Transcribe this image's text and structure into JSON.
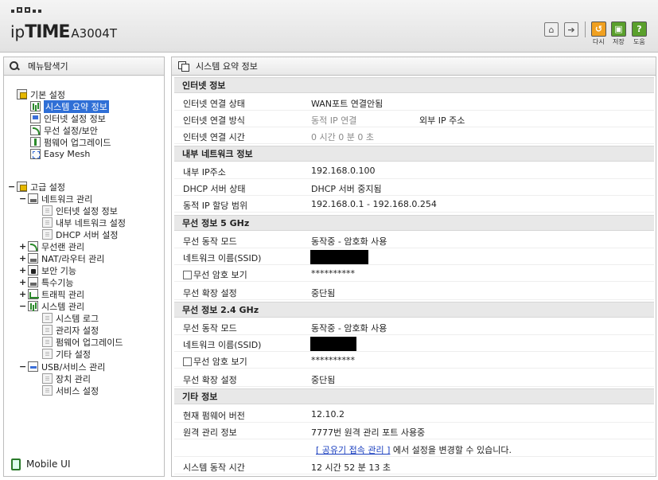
{
  "header": {
    "brand_ip": "ip",
    "brand_time": "TIME",
    "model": "A3004T",
    "buttons": [
      {
        "icon": "home-icon",
        "label": ""
      },
      {
        "icon": "logout-icon",
        "label": ""
      },
      {
        "icon": "refresh-icon",
        "label": "다시",
        "color": "#f0a020"
      },
      {
        "icon": "save-icon",
        "label": "저장",
        "color": "#5aa02c"
      },
      {
        "icon": "help-icon",
        "label": "도움",
        "color": "#5aa02c"
      }
    ]
  },
  "sidebar": {
    "title": "메뉴탐색기",
    "basic": {
      "label": "기본 설정",
      "items": [
        "시스템 요약 정보",
        "인터넷 설정 정보",
        "무선 설정/보안",
        "펌웨어 업그레이드",
        "Easy Mesh"
      ]
    },
    "advanced": {
      "label": "고급 설정",
      "network": {
        "label": "네트워크 관리",
        "items": [
          "인터넷 설정 정보",
          "내부 네트워크 설정",
          "DHCP 서버 설정"
        ]
      },
      "groups": [
        "무선랜 관리",
        "NAT/라우터 관리",
        "보안 기능",
        "특수기능",
        "트래픽 관리"
      ],
      "system": {
        "label": "시스템 관리",
        "items": [
          "시스템 로그",
          "관리자 설정",
          "펌웨어 업그레이드",
          "기타 설정"
        ]
      },
      "usb": {
        "label": "USB/서비스 관리",
        "items": [
          "장치 관리",
          "서비스 설정"
        ]
      }
    },
    "mobile": "Mobile UI"
  },
  "main": {
    "title": "시스템 요약 정보",
    "internet": {
      "header": "인터넷 정보",
      "status_label": "인터넷 연결 상태",
      "status_value": "WAN포트 연결안됨",
      "method_label": "인터넷 연결 방식",
      "method_value": "동적 IP 연결",
      "external_ip_label": "외부 IP 주소",
      "time_label": "인터넷 연결 시간",
      "time_value": "0 시간 0 분 0 초"
    },
    "lan": {
      "header": "내부 네트워크 정보",
      "ip_label": "내부 IP주소",
      "ip_value": "192.168.0.100",
      "dhcp_label": "DHCP 서버 상태",
      "dhcp_value": "DHCP 서버 중지됨",
      "range_label": "동적 IP 할당 범위",
      "range_value": "192.168.0.1 -  192.168.0.254"
    },
    "wifi5": {
      "header": "무선 정보 5 GHz",
      "mode_label": "무선 동작 모드",
      "mode_value": "동작중 - 암호화 사용",
      "ssid_label": "네트워크 이름(SSID)",
      "pw_label": "무선 암호 보기",
      "pw_value": "**********",
      "ext_label": "무선 확장 설정",
      "ext_value": "중단됨"
    },
    "wifi24": {
      "header": "무선 정보 2.4 GHz",
      "mode_label": "무선 동작 모드",
      "mode_value": "동작중 - 암호화 사용",
      "ssid_label": "네트워크 이름(SSID)",
      "pw_label": "무선 암호 보기",
      "pw_value": "**********",
      "ext_label": "무선 확장 설정",
      "ext_value": "중단됨"
    },
    "etc": {
      "header": "기타 정보",
      "fw_label": "현재 펌웨어 버전",
      "fw_value": "12.10.2",
      "remote_label": "원격 관리 정보",
      "remote_value": "7777번 원격 관리 포트 사용중",
      "share_link": "[ 공유기 접속 관리 ]",
      "share_text": " 에서 설정을 변경할 수 있습니다.",
      "uptime_label": "시스템 동작 시간",
      "uptime_value": "12 시간 52 분 13 초"
    }
  }
}
